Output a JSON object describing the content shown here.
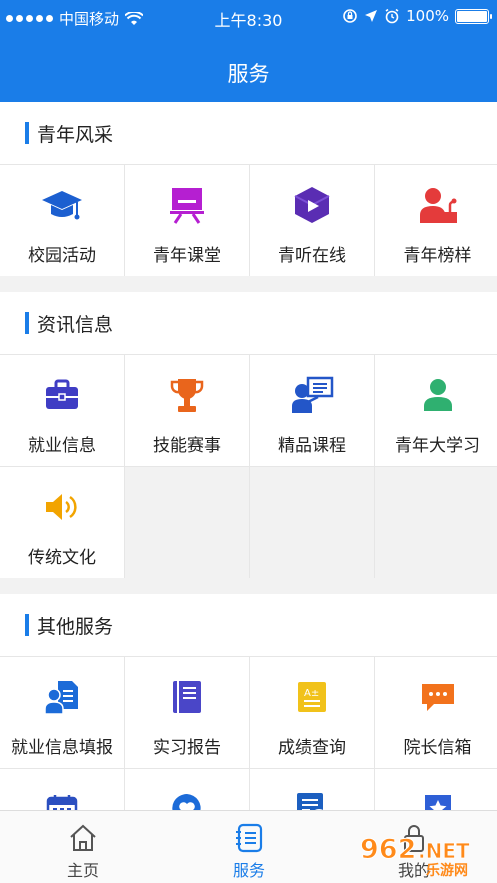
{
  "status_bar": {
    "carrier": "中国移动",
    "time": "上午8:30",
    "battery": "100%"
  },
  "header": {
    "title": "服务"
  },
  "sections": [
    {
      "title": "青年风采",
      "items": [
        {
          "label": "校园活动",
          "icon": "graduation-cap-icon",
          "color": "#1c5fd0"
        },
        {
          "label": "青年课堂",
          "icon": "easel-board-icon",
          "color": "#b51fd1"
        },
        {
          "label": "青听在线",
          "icon": "play-cube-icon",
          "color": "#5a2db3"
        },
        {
          "label": "青年榜样",
          "icon": "speaker-podium-icon",
          "color": "#e43b3b"
        }
      ]
    },
    {
      "title": "资讯信息",
      "items": [
        {
          "label": "就业信息",
          "icon": "briefcase-icon",
          "color": "#3f3dc4"
        },
        {
          "label": "技能赛事",
          "icon": "trophy-icon",
          "color": "#e9651c"
        },
        {
          "label": "精品课程",
          "icon": "online-lecture-icon",
          "color": "#2356c8"
        },
        {
          "label": "青年大学习",
          "icon": "person-icon",
          "color": "#2fb070"
        },
        {
          "label": "传统文化",
          "icon": "speaker-icon",
          "color": "#f2a400"
        }
      ]
    },
    {
      "title": "其他服务",
      "items": [
        {
          "label": "就业信息填报",
          "icon": "user-document-icon",
          "color": "#1c6bd8"
        },
        {
          "label": "实习报告",
          "icon": "notebook-icon",
          "color": "#4a46c8"
        },
        {
          "label": "成绩查询",
          "icon": "grade-card-icon",
          "color": "#f1c21a"
        },
        {
          "label": "院长信箱",
          "icon": "chat-bubble-icon",
          "color": "#f2721c"
        },
        {
          "label": "",
          "icon": "calendar-icon",
          "color": "#2b4fc0"
        },
        {
          "label": "",
          "icon": "heart-bubble-icon",
          "color": "#1c6bd8"
        },
        {
          "label": "",
          "icon": "document-alert-icon",
          "color": "#1c5fc0"
        },
        {
          "label": "",
          "icon": "star-shield-icon",
          "color": "#2e5fd6"
        }
      ]
    }
  ],
  "tabbar": {
    "tabs": [
      {
        "label": "主页",
        "icon": "home-icon"
      },
      {
        "label": "服务",
        "icon": "service-list-icon",
        "active": true
      },
      {
        "label": "我的",
        "icon": "lock-icon"
      }
    ]
  },
  "watermark": {
    "text": "962.NET",
    "subtext": "乐游网"
  },
  "colors": {
    "primary": "#1a7de8",
    "background": "#f2f2f2"
  }
}
